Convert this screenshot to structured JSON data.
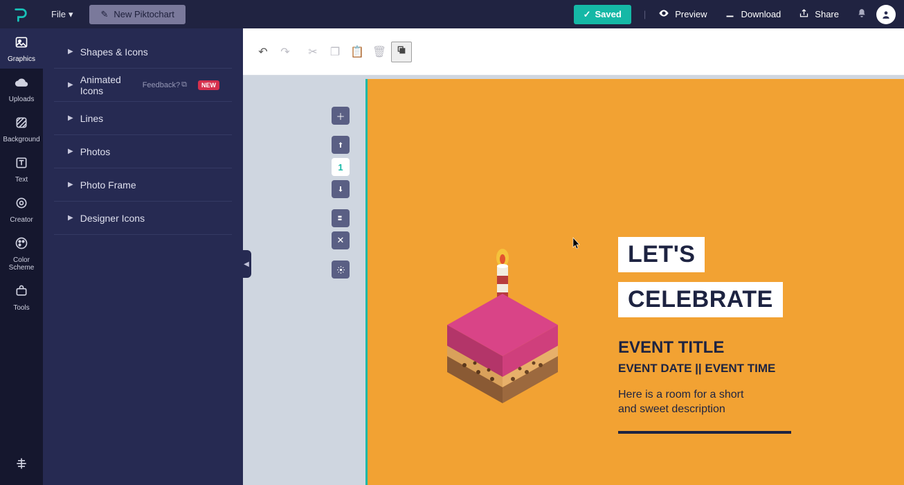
{
  "header": {
    "file_label": "File",
    "new_button": "New Piktochart",
    "saved_label": "Saved",
    "preview": "Preview",
    "download": "Download",
    "share": "Share"
  },
  "rail": {
    "items": [
      {
        "label": "Graphics",
        "active": true
      },
      {
        "label": "Uploads",
        "active": false
      },
      {
        "label": "Background",
        "active": false
      },
      {
        "label": "Text",
        "active": false
      },
      {
        "label": "Creator",
        "active": false
      },
      {
        "label": "Color Scheme",
        "active": false
      },
      {
        "label": "Tools",
        "active": false
      }
    ]
  },
  "panel": {
    "items": [
      {
        "label": "Shapes & Icons"
      },
      {
        "label": "Animated Icons",
        "feedback": "Feedback?",
        "badge": "NEW"
      },
      {
        "label": "Lines"
      },
      {
        "label": "Photos"
      },
      {
        "label": "Photo Frame"
      },
      {
        "label": "Designer Icons"
      }
    ]
  },
  "mini_controls": {
    "page_number": "1"
  },
  "canvas": {
    "headline1": "LET'S",
    "headline2": "CELEBRATE",
    "event_title": "EVENT TITLE",
    "event_meta": "EVENT DATE || EVENT TIME",
    "event_desc": "Here is a room for a short and sweet description"
  }
}
